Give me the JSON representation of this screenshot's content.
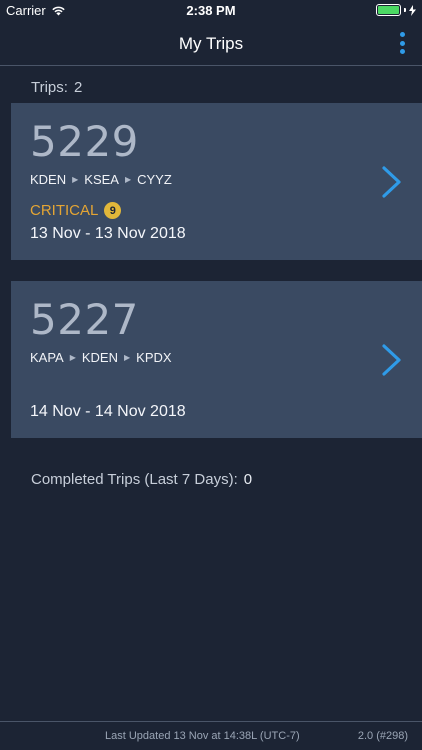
{
  "status_bar": {
    "carrier": "Carrier",
    "time": "2:38 PM",
    "battery_level": 1.0,
    "battery_color": "#4cd964"
  },
  "nav": {
    "title": "My Trips",
    "menu_icon": "more-vertical-icon",
    "accent": "#2f9be8"
  },
  "trips_summary": {
    "label": "Trips:",
    "count": "2"
  },
  "trips": [
    {
      "number": "5229",
      "route": [
        "KDEN",
        "KSEA",
        "CYYZ"
      ],
      "status": "CRITICAL",
      "status_count": "9",
      "status_color": "#e4a534",
      "dates": "13 Nov - 13 Nov 2018"
    },
    {
      "number": "5227",
      "route": [
        "KAPA",
        "KDEN",
        "KPDX"
      ],
      "status": "",
      "status_count": "",
      "dates": "14 Nov - 14 Nov 2018"
    }
  ],
  "completed": {
    "label": "Completed Trips (Last 7 Days):",
    "count": "0"
  },
  "footer": {
    "last_updated": "Last Updated 13 Nov at 14:38L (UTC-7)",
    "version": "2.0 (#298)"
  }
}
